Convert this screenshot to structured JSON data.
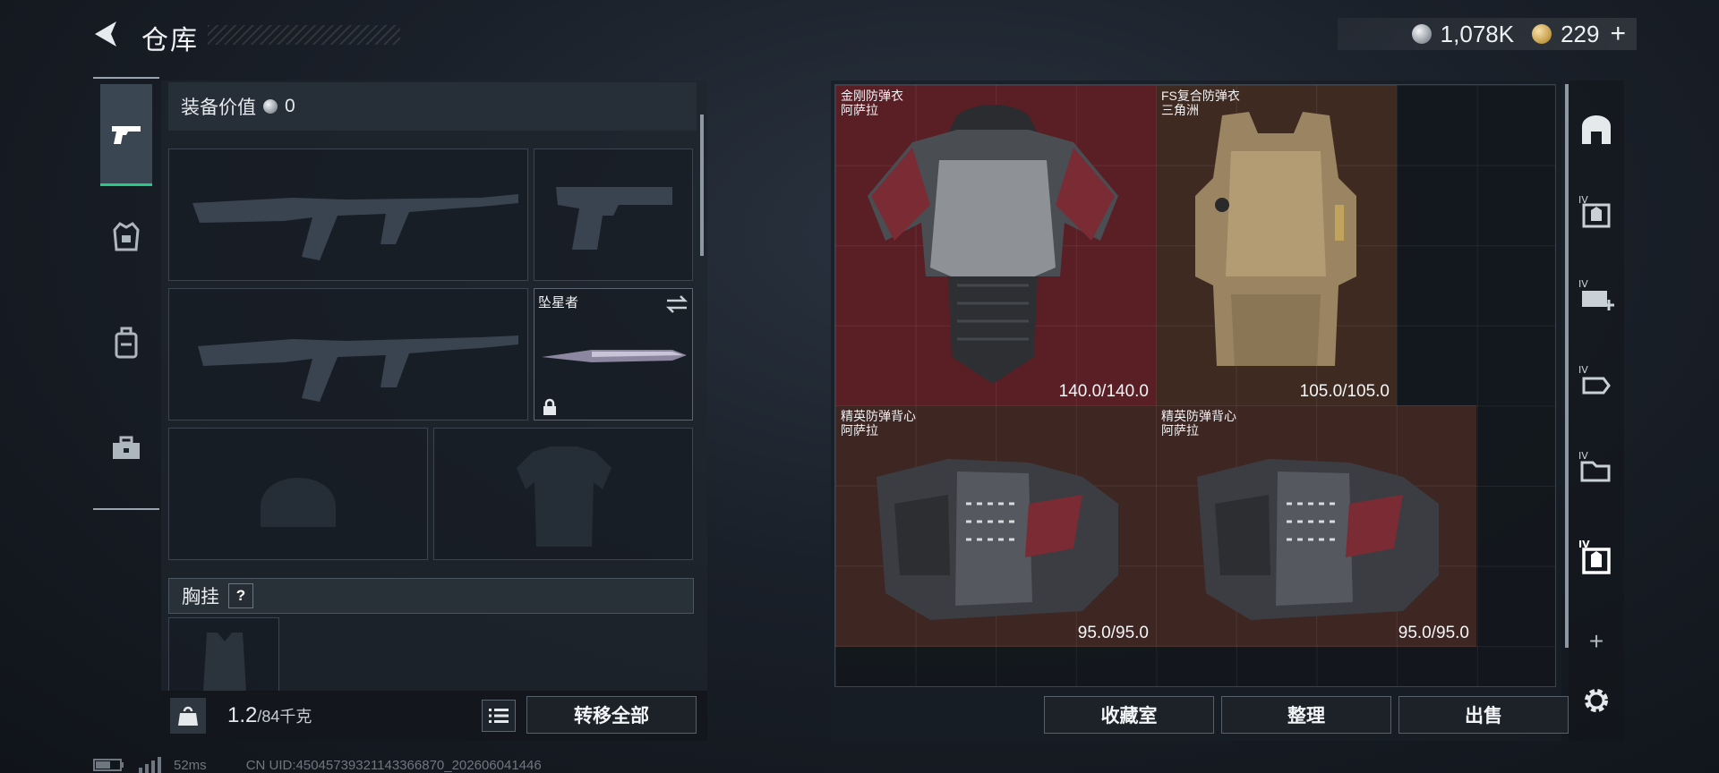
{
  "header": {
    "title": "仓库",
    "currency": [
      {
        "icon": "silver-coin-icon",
        "value": "1,078K"
      },
      {
        "icon": "gold-coin-icon",
        "value": "229"
      }
    ],
    "add_label": "+"
  },
  "rail": {
    "items": [
      {
        "icon": "pistol-icon",
        "active": true
      },
      {
        "icon": "armor-icon",
        "active": false
      },
      {
        "icon": "backpack-icon",
        "active": false
      },
      {
        "icon": "toolbox-icon",
        "active": false
      }
    ]
  },
  "loadout": {
    "equip_value_label": "装备价值",
    "equip_value": "0",
    "melee_name": "坠星者",
    "vest_label": "胸挂",
    "help_label": "?",
    "weight_current": "1.2",
    "weight_max": "/84千克",
    "transfer_all_label": "转移全部"
  },
  "stash": {
    "items": [
      {
        "name": "金刚防弹衣",
        "sub": "阿萨拉",
        "durability": "140.0/140.0",
        "color": "#5a1e25"
      },
      {
        "name": "FS复合防弹衣",
        "sub": "三角洲",
        "durability": "105.0/105.0",
        "color": "#3f2a22"
      },
      {
        "name": "精英防弹背心",
        "sub": "阿萨拉",
        "durability": "95.0/95.0",
        "color": "#3e2622"
      },
      {
        "name": "精英防弹背心",
        "sub": "阿萨拉",
        "durability": "95.0/95.0",
        "color": "#3e2622"
      }
    ],
    "buttons": {
      "collection": "收藏室",
      "sort": "整理",
      "sell": "出售"
    }
  },
  "tools": {
    "items": [
      "home-icon",
      "filter-iv-armor-icon",
      "filter-iv-medical-icon",
      "filter-iv-ammo-icon",
      "filter-iv-folder-icon",
      "filter-iv-selected-icon"
    ],
    "add_label": "+"
  },
  "status": {
    "ping": "52ms",
    "uid": "CN UID:450457393211433668​70_202606041446"
  }
}
